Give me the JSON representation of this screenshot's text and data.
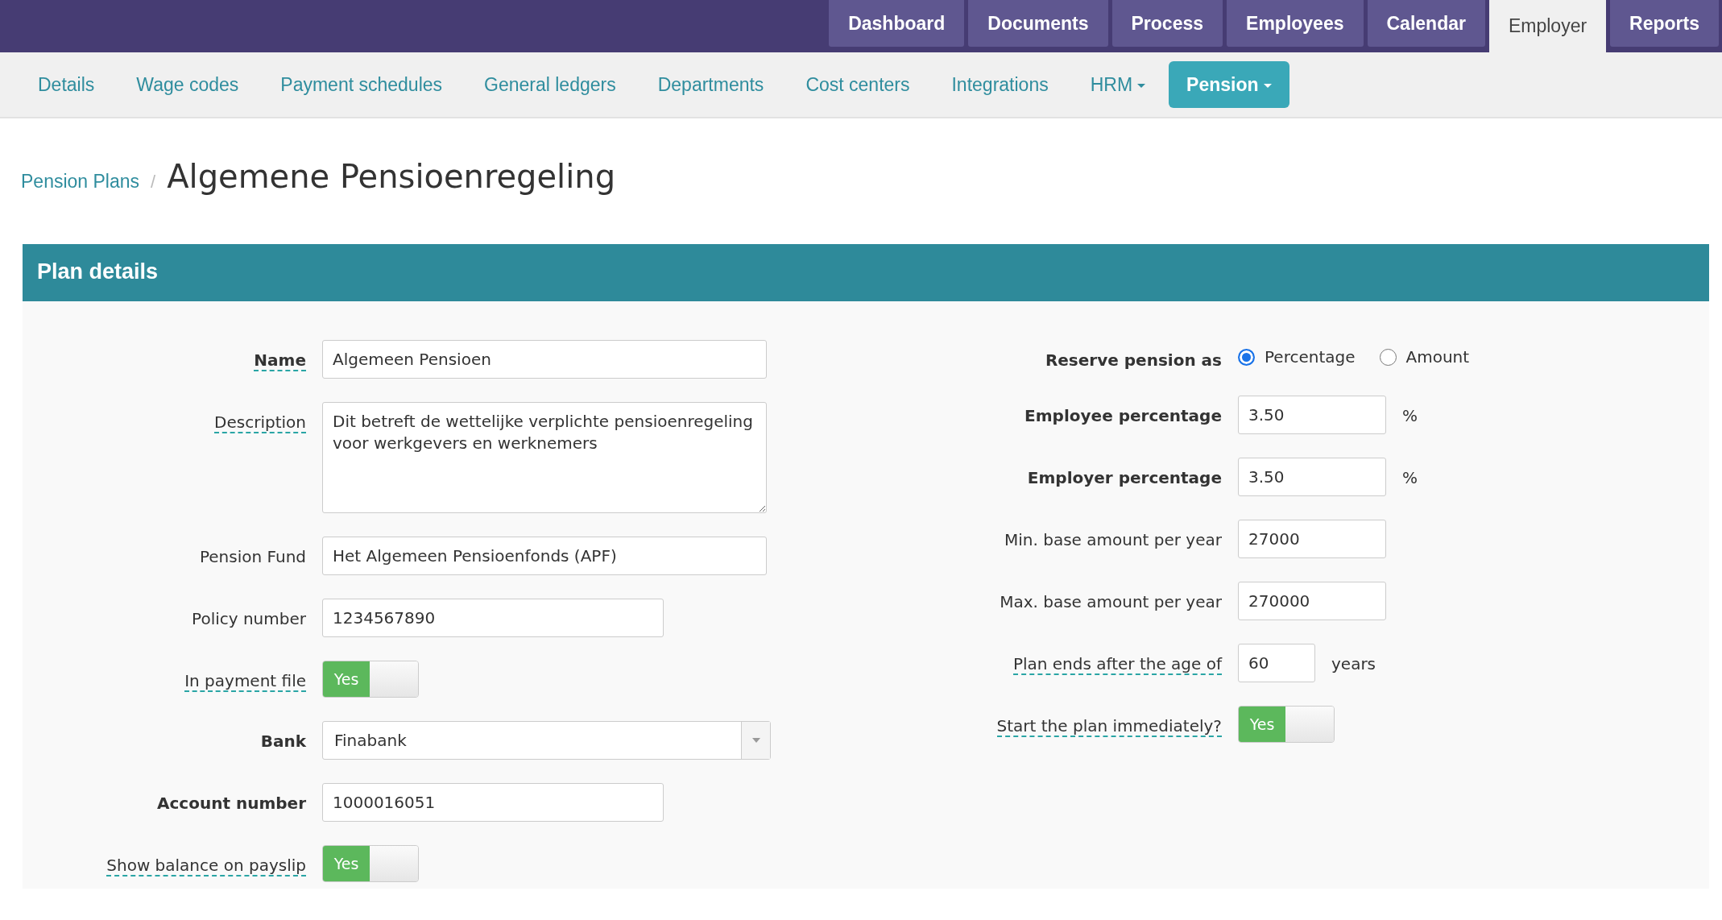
{
  "top_nav": [
    {
      "label": "Dashboard",
      "selected": false
    },
    {
      "label": "Documents",
      "selected": false
    },
    {
      "label": "Process",
      "selected": false
    },
    {
      "label": "Employees",
      "selected": false
    },
    {
      "label": "Calendar",
      "selected": false
    },
    {
      "label": "Employer",
      "selected": true
    },
    {
      "label": "Reports",
      "selected": false
    }
  ],
  "sub_nav": [
    {
      "label": "Details",
      "selected": false,
      "dropdown": false
    },
    {
      "label": "Wage codes",
      "selected": false,
      "dropdown": false
    },
    {
      "label": "Payment schedules",
      "selected": false,
      "dropdown": false
    },
    {
      "label": "General ledgers",
      "selected": false,
      "dropdown": false
    },
    {
      "label": "Departments",
      "selected": false,
      "dropdown": false
    },
    {
      "label": "Cost centers",
      "selected": false,
      "dropdown": false
    },
    {
      "label": "Integrations",
      "selected": false,
      "dropdown": false
    },
    {
      "label": "HRM",
      "selected": false,
      "dropdown": true
    },
    {
      "label": "Pension",
      "selected": true,
      "dropdown": true
    }
  ],
  "breadcrumb": {
    "parent": "Pension Plans",
    "separator": "/",
    "title": "Algemene Pensioenregeling"
  },
  "panel": {
    "title": "Plan details",
    "left_fields": [
      {
        "kind": "text",
        "label": "Name",
        "bold": true,
        "tooltip": true,
        "value": "Algemeen Pensioen"
      },
      {
        "kind": "textarea",
        "label": "Description",
        "bold": false,
        "tooltip": true,
        "value": "Dit betreft de wettelijke verplichte pensioenregeling voor werkgevers en werknemers"
      },
      {
        "kind": "text",
        "label": "Pension Fund",
        "bold": false,
        "tooltip": false,
        "value": "Het Algemeen Pensioenfonds (APF)"
      },
      {
        "kind": "text",
        "label": "Policy number",
        "bold": false,
        "tooltip": false,
        "value": "1234567890"
      },
      {
        "kind": "toggle",
        "label": "In payment file",
        "bold": false,
        "tooltip": true,
        "on": true,
        "on_label": "Yes"
      },
      {
        "kind": "select",
        "label": "Bank",
        "bold": true,
        "tooltip": false,
        "value": "Finabank"
      },
      {
        "kind": "text",
        "label": "Account number",
        "bold": true,
        "tooltip": false,
        "value": "1000016051"
      },
      {
        "kind": "toggle",
        "label": "Show balance on payslip",
        "bold": false,
        "tooltip": true,
        "on": true,
        "on_label": "Yes"
      }
    ],
    "right_fields": [
      {
        "kind": "radio",
        "label": "Reserve pension as",
        "bold": true,
        "tooltip": false,
        "options": [
          {
            "label": "Percentage",
            "selected": true
          },
          {
            "label": "Amount",
            "selected": false
          }
        ]
      },
      {
        "kind": "text",
        "label": "Employee percentage",
        "bold": true,
        "tooltip": false,
        "value": "3.50",
        "suffix": "%"
      },
      {
        "kind": "text",
        "label": "Employer percentage",
        "bold": true,
        "tooltip": false,
        "value": "3.50",
        "suffix": "%"
      },
      {
        "kind": "text",
        "label": "Min. base amount per year",
        "bold": false,
        "tooltip": false,
        "value": "27000"
      },
      {
        "kind": "text",
        "label": "Max. base amount per year",
        "bold": false,
        "tooltip": false,
        "value": "270000"
      },
      {
        "kind": "text",
        "label": "Plan ends after the age of",
        "bold": false,
        "tooltip": true,
        "value": "60",
        "suffix": "years"
      },
      {
        "kind": "toggle",
        "label": "Start the plan immediately?",
        "bold": false,
        "tooltip": true,
        "on": true,
        "on_label": "Yes"
      }
    ]
  }
}
